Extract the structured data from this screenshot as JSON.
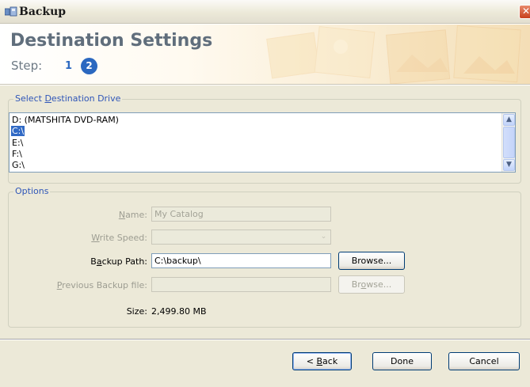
{
  "window": {
    "title": "Backup",
    "close_glyph": "✕"
  },
  "header": {
    "title": "Destination Settings",
    "step_label": "Step:",
    "step_one": "1",
    "step_two": "2"
  },
  "drive_group": {
    "legend_pre": "Select ",
    "legend_key": "D",
    "legend_post": "estination Drive",
    "items": [
      {
        "label": "D: (MATSHITA DVD-RAM)",
        "selected": false
      },
      {
        "label": "C:\\",
        "selected": true
      },
      {
        "label": "E:\\",
        "selected": false
      },
      {
        "label": "F:\\",
        "selected": false
      },
      {
        "label": "G:\\",
        "selected": false
      }
    ],
    "scroll_up": "▲",
    "scroll_down": "▼"
  },
  "options": {
    "legend": "Options",
    "name_label_key": "N",
    "name_label_post": "ame:",
    "name_value": "My Catalog",
    "write_speed_label_key": "W",
    "write_speed_label_post": "rite Speed:",
    "write_speed_value": "",
    "write_speed_arrow": "⌄",
    "backup_path_label_pre": "B",
    "backup_path_label_key": "a",
    "backup_path_label_post": "ckup Path:",
    "backup_path_value": "C:\\backup\\",
    "browse_label_pre": "Browse...",
    "prev_backup_label_key": "P",
    "prev_backup_label_post": "revious Backup file:",
    "prev_backup_value": "",
    "browse2_label_pre": "Br",
    "browse2_label_key": "o",
    "browse2_label_post": "wse...",
    "size_label": "Size:",
    "size_value": "2,499.80 MB"
  },
  "footer": {
    "back_pre": "< ",
    "back_key": "B",
    "back_post": "ack",
    "done_label": "Done",
    "cancel_label": "Cancel"
  },
  "colors": {
    "selection": "#316ac5",
    "legend_text": "#2f56b8",
    "step_accent": "#2b68c0",
    "title_text": "#606e7c"
  }
}
